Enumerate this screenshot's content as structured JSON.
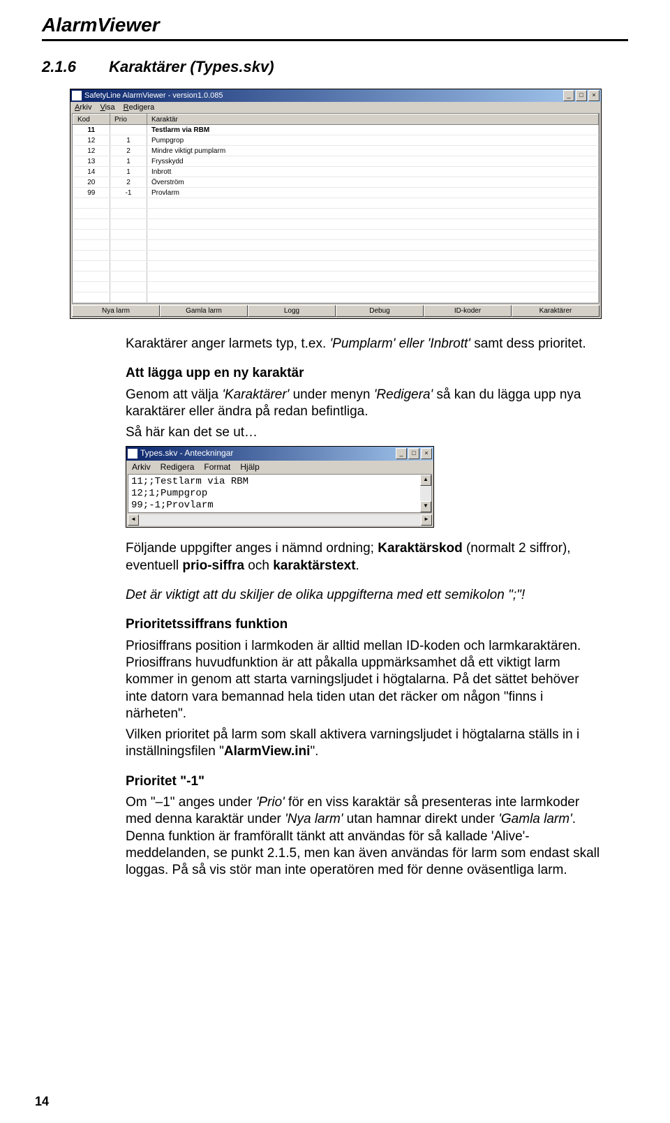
{
  "header": {
    "title": "AlarmViewer"
  },
  "section": {
    "number": "2.1.6",
    "title": "Karaktärer (Types.skv)"
  },
  "app": {
    "title": "SafetyLine AlarmViewer - version1.0.085",
    "menu": {
      "arkiv": "Arkiv",
      "visa": "Visa",
      "redigera": "Redigera"
    },
    "columns": {
      "kod": "Kod",
      "prio": "Prio",
      "karaktar": "Karaktär"
    },
    "rows": [
      {
        "kod": "11",
        "prio": "",
        "kar": "Testlarm via RBM",
        "bold": true
      },
      {
        "kod": "12",
        "prio": "1",
        "kar": "Pumpgrop"
      },
      {
        "kod": "12",
        "prio": "2",
        "kar": "Mindre viktigt pumplarm"
      },
      {
        "kod": "13",
        "prio": "1",
        "kar": "Frysskydd"
      },
      {
        "kod": "14",
        "prio": "1",
        "kar": "Inbrott"
      },
      {
        "kod": "20",
        "prio": "2",
        "kar": "Överström"
      },
      {
        "kod": "99",
        "prio": "-1",
        "kar": "Provlarm"
      }
    ],
    "tabs": {
      "nya": "Nya larm",
      "gamla": "Gamla larm",
      "logg": "Logg",
      "debug": "Debug",
      "id": "ID-koder",
      "kar": "Karaktärer"
    }
  },
  "text1": {
    "intro_a": "Karaktärer anger larmets typ, t.ex. ",
    "intro_i": "'Pumplarm' eller 'Inbrott'",
    "intro_b": " samt dess prioritet.",
    "add_head": "Att lägga upp en ny karaktär",
    "add_a": "Genom att välja ",
    "add_i1": "'Karaktärer'",
    "add_b": " under menyn ",
    "add_i2": "'Redigera'",
    "add_c": " så kan du lägga upp nya karaktärer eller ändra på redan befintliga.",
    "add_d": "Så här kan det se ut…"
  },
  "notepad": {
    "title": "Types.skv - Anteckningar",
    "menu": {
      "arkiv": "Arkiv",
      "redigera": "Redigera",
      "format": "Format",
      "hjalp": "Hjälp"
    },
    "content": "11;;Testlarm via RBM\n12;1;Pumpgrop\n99;-1;Provlarm"
  },
  "text2": {
    "fields_a": "Följande uppgifter anges i nämnd ordning; ",
    "fields_b1": "Karaktärskod",
    "fields_c": " (normalt 2 siffror), eventuell ",
    "fields_b2": "prio-siffra",
    "fields_d": " och ",
    "fields_b3": "karaktärstext",
    "fields_e": ".",
    "semi": "Det är viktigt att du skiljer de olika uppgifterna med ett semikolon \";\"!",
    "prio_head": "Prioritetssiffrans funktion",
    "prio_body_a": "Priosiffrans position i larmkoden är alltid mellan ID-koden och larmkaraktären. Priosiffrans huvudfunktion är att påkalla uppmärksamhet då ett viktigt larm kommer in genom att starta varningsljudet i högtalarna. På det sättet behöver inte datorn vara bemannad hela tiden utan det räcker om någon \"finns i närheten\".",
    "prio_body_b": "Vilken prioritet på larm som skall aktivera varningsljudet i högtalarna ställs in i inställningsfilen \"",
    "prio_ini": "AlarmView.ini",
    "prio_body_c": "\".",
    "neg_head": "Prioritet \"-1\"",
    "neg_a": "Om \"–1\" anges under ",
    "neg_i1": "'Prio'",
    "neg_b": " för en viss karaktär så presenteras inte larmkoder med denna karaktär under ",
    "neg_i2": "'Nya larm'",
    "neg_c": " utan hamnar direkt under ",
    "neg_i3": "'Gamla larm'",
    "neg_d": ". Denna funktion är framförallt tänkt att användas för så kallade 'Alive'-meddelanden, se punkt 2.1.5, men kan även användas för larm som endast skall loggas. På så vis stör man inte operatören med för denne oväsentliga larm."
  },
  "page_number": "14"
}
